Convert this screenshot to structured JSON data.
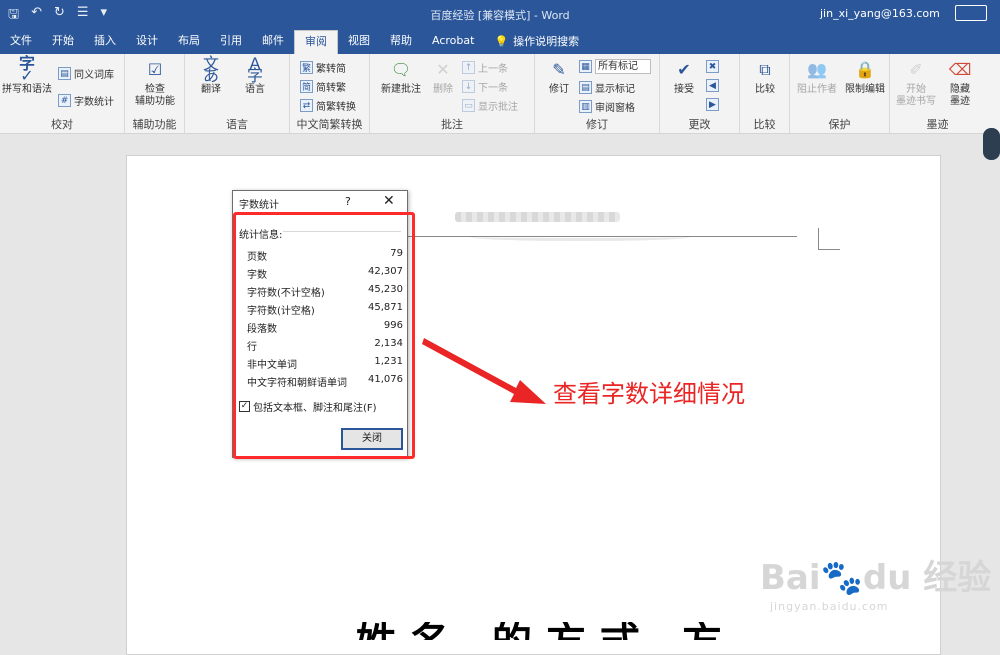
{
  "window": {
    "title": "百度经验 [兼容模式] - Word",
    "user": "jin_xi_yang@163.com"
  },
  "tabs": [
    "文件",
    "开始",
    "插入",
    "设计",
    "布局",
    "引用",
    "邮件",
    "审阅",
    "视图",
    "帮助",
    "Acrobat"
  ],
  "active_tab": "审阅",
  "tell_me": "操作说明搜索",
  "ribbon": {
    "proofing": {
      "label": "校对",
      "spelling": "拼写和语法",
      "thesaurus": "同义词库",
      "wordcount": "字数统计"
    },
    "accessibility": {
      "label": "辅助功能",
      "check": "检查\n辅助功能"
    },
    "language": {
      "label": "语言",
      "translate": "翻译",
      "language": "语言"
    },
    "chinese": {
      "label": "中文简繁转换",
      "t2s": "繁转简",
      "s2t": "简转繁",
      "convert": "简繁转换"
    },
    "comments": {
      "label": "批注",
      "new": "新建批注",
      "delete": "删除",
      "prev": "上一条",
      "next": "下一条",
      "show": "显示批注"
    },
    "tracking": {
      "label": "修订",
      "track": "修订",
      "markup": "所有标记",
      "show_markup": "显示标记",
      "pane": "审阅窗格"
    },
    "changes": {
      "label": "更改",
      "accept": "接受"
    },
    "compare": {
      "label": "比较",
      "compare": "比较"
    },
    "protect": {
      "label": "保护",
      "block": "阻止作者",
      "restrict": "限制编辑"
    },
    "ink": {
      "label": "墨迹",
      "start": "开始\n墨迹书写",
      "hide": "隐藏\n墨迹"
    }
  },
  "dialog": {
    "title": "字数统计",
    "help": "?",
    "close_x": "✕",
    "section": "统计信息:",
    "stats": [
      {
        "label": "页数",
        "value": "79"
      },
      {
        "label": "字数",
        "value": "42,307"
      },
      {
        "label": "字符数(不计空格)",
        "value": "45,230"
      },
      {
        "label": "字符数(计空格)",
        "value": "45,871"
      },
      {
        "label": "段落数",
        "value": "996"
      },
      {
        "label": "行",
        "value": "2,134"
      },
      {
        "label": "非中文单词",
        "value": "1,231"
      },
      {
        "label": "中文字符和朝鲜语单词",
        "value": "41,076"
      }
    ],
    "checkbox": "包括文本框、脚注和尾注(F)",
    "checkbox_checked": true,
    "close_button": "关闭"
  },
  "annotation": "查看字数详细情况",
  "doc_big_text": "姓名 的方式 方法",
  "watermark": {
    "logo": "Bai du 经验",
    "url": "jingyan.baidu.com"
  },
  "colors": {
    "titlebar": "#2b579a",
    "annotation": "#ea2525",
    "highlight": "#ff2b2b"
  }
}
